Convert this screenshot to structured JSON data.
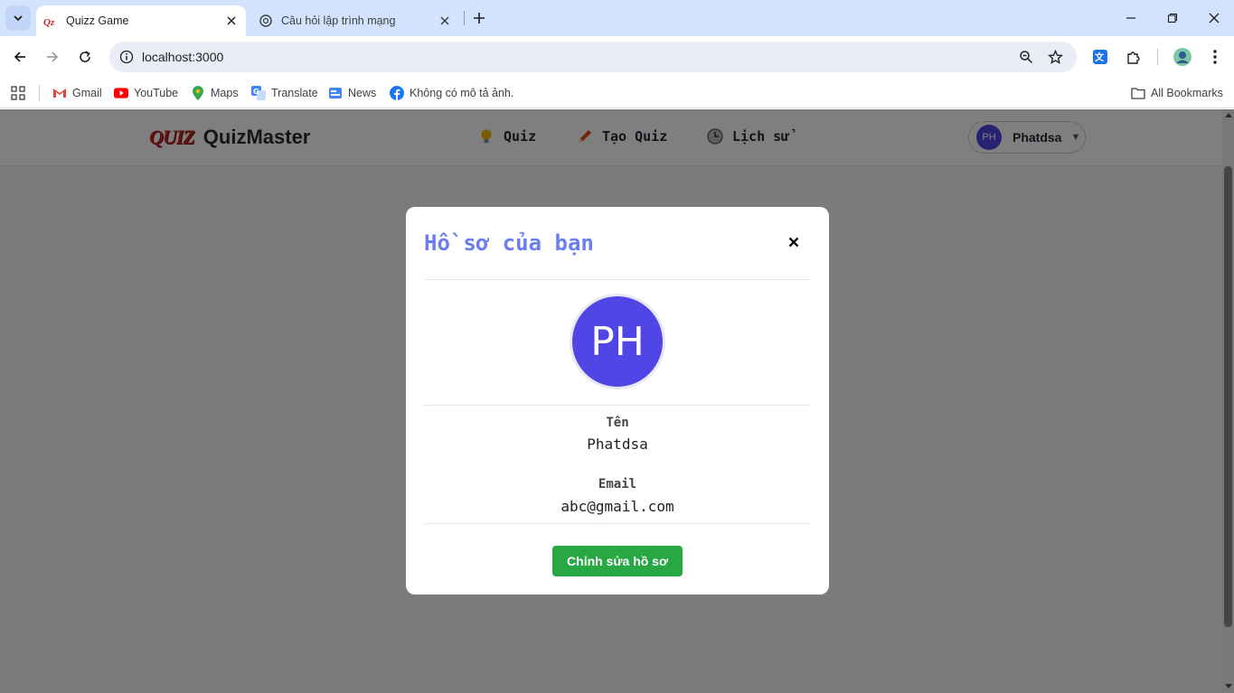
{
  "browser": {
    "tabs": [
      {
        "title": "Quizz Game",
        "favicon": "quiz-logo-icon",
        "active": true
      },
      {
        "title": "Câu hỏi lập trình mạng",
        "favicon": "chatgpt-icon",
        "active": false
      }
    ],
    "url": "localhost:3000",
    "bookmarks": [
      {
        "label": "Gmail",
        "icon": "gmail-icon"
      },
      {
        "label": "YouTube",
        "icon": "youtube-icon"
      },
      {
        "label": "Maps",
        "icon": "maps-icon"
      },
      {
        "label": "Translate",
        "icon": "translate-icon"
      },
      {
        "label": "News",
        "icon": "news-icon"
      },
      {
        "label": "Không có mô tả ảnh.",
        "icon": "facebook-icon"
      }
    ],
    "all_bookmarks_label": "All Bookmarks"
  },
  "app": {
    "logo_mark": "QUIZ",
    "logo_text": "QuizMaster",
    "nav": [
      {
        "label": "Quiz",
        "icon": "lightbulb-icon"
      },
      {
        "label": "Tạo Quiz",
        "icon": "pencil-icon"
      },
      {
        "label": "Lịch sử",
        "icon": "clock-icon"
      }
    ],
    "user": {
      "initials": "PH",
      "name": "Phatdsa",
      "caret": "▼"
    }
  },
  "modal": {
    "title": "Hồ sơ của bạn",
    "close": "×",
    "avatar_initials": "PH",
    "name_label": "Tên",
    "name_value": "Phatdsa",
    "email_label": "Email",
    "email_value": "abc@gmail.com",
    "edit_button": "Chỉnh sửa hồ sơ"
  },
  "colors": {
    "accent_title": "#6b7ef0",
    "avatar": "#4f46e5",
    "edit_button": "#28a745"
  }
}
